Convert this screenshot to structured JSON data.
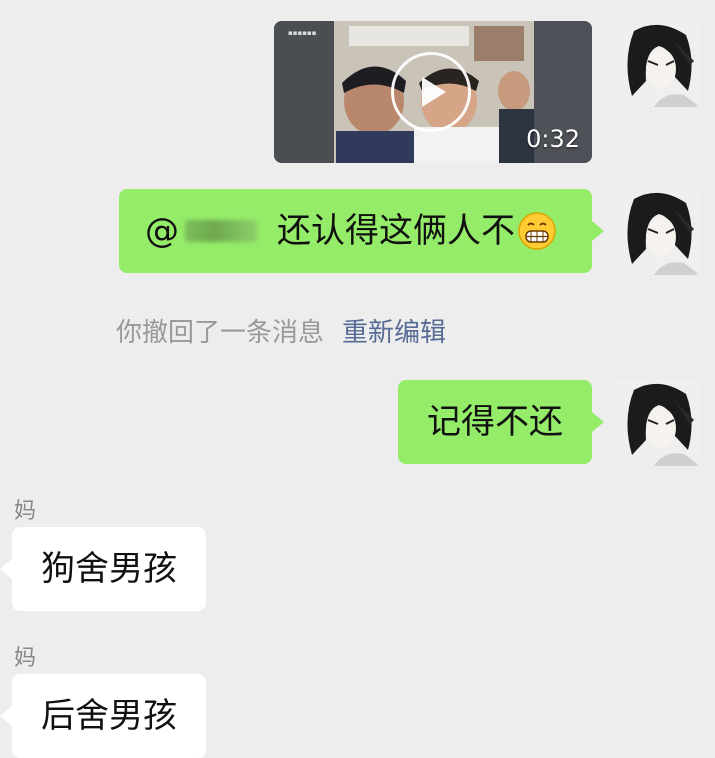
{
  "messages": [
    {
      "type": "video",
      "side": "right",
      "duration": "0:32"
    },
    {
      "type": "text",
      "side": "right",
      "mention": "@",
      "text": "还认得这俩人不",
      "emoji": "grinning-grimace-emoji"
    },
    {
      "type": "system",
      "text": "你撤回了一条消息",
      "link": "重新编辑"
    },
    {
      "type": "text",
      "side": "right",
      "text": "记得不还"
    },
    {
      "type": "text",
      "side": "left",
      "sender": "妈",
      "text": "狗舍男孩"
    },
    {
      "type": "text",
      "side": "left",
      "sender": "妈",
      "text": "后舍男孩"
    }
  ],
  "icons": {
    "play": "play-icon",
    "avatar": "anime-avatar",
    "emoji": "grinning-grimace-emoji"
  },
  "colors": {
    "background": "#ededed",
    "outgoing_bubble": "#95ec69",
    "incoming_bubble": "#ffffff",
    "system_text": "#999999",
    "link_text": "#576b95"
  }
}
